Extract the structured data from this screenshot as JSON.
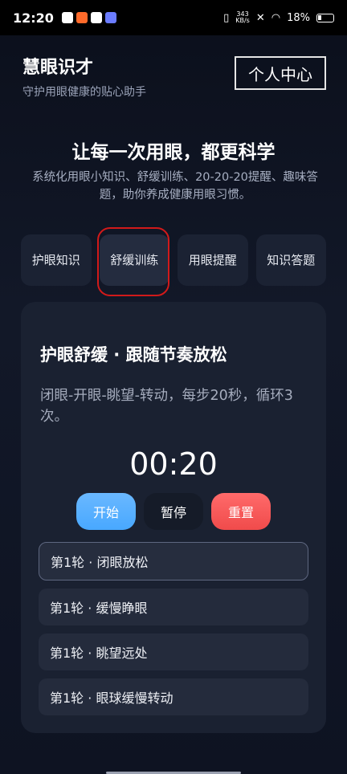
{
  "status_bar": {
    "time": "12:20",
    "speed_value": "343",
    "speed_unit": "KB/s",
    "battery": "18%"
  },
  "header": {
    "title": "慧眼识才",
    "subtitle": "守护用眼健康的贴心助手",
    "profile_label": "个人中心"
  },
  "hero": {
    "title": "让每一次用眼，都更科学",
    "desc": "系统化用眼小知识、舒缓训练、20-20-20提醒、趣味答题，助你养成健康用眼习惯。"
  },
  "tabs": [
    {
      "label": "护眼知识"
    },
    {
      "label": "舒缓训练"
    },
    {
      "label": "用眼提醒"
    },
    {
      "label": "知识答题"
    }
  ],
  "training": {
    "title": "护眼舒缓 · 跟随节奏放松",
    "desc": "闭眼-开眼-眺望-转动，每步20秒，循环3次。",
    "timer": "00:20",
    "start_label": "开始",
    "pause_label": "暂停",
    "reset_label": "重置",
    "steps": [
      {
        "label": "第1轮 · 闭眼放松"
      },
      {
        "label": "第1轮 · 缓慢睁眼"
      },
      {
        "label": "第1轮 · 眺望远处"
      },
      {
        "label": "第1轮 · 眼球缓慢转动"
      }
    ]
  },
  "colors": {
    "accent_blue": "#48a8ff",
    "accent_red": "#f04b4b",
    "highlight": "#d11a1a"
  }
}
